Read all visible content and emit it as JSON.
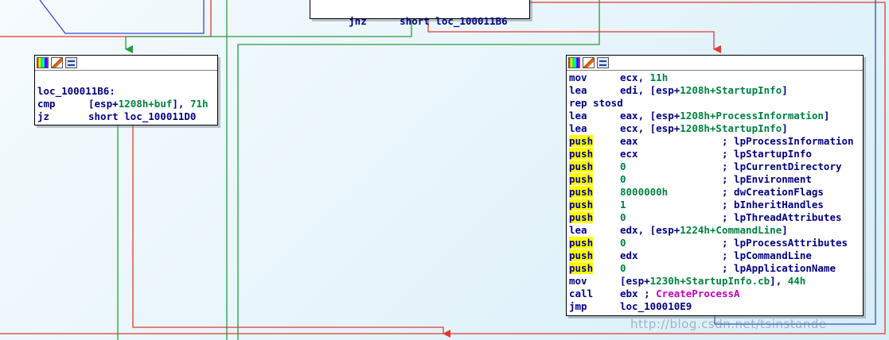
{
  "colors": {
    "accent_true": "#2b9a3b",
    "accent_false": "#e3392f",
    "accent_jump": "#3a46c9",
    "highlight": "#ffff00",
    "mnemonic": "#000080",
    "operand_num": "#008040",
    "api_call": "#c000c0"
  },
  "toolbar_icons": [
    "color-palette-icon",
    "rename-icon",
    "graph-overview-icon"
  ],
  "top_block": {
    "mnemonic": "jnz",
    "operand": "short loc_100011B6"
  },
  "left_block": {
    "label": "loc_100011B6:",
    "lines": [
      {
        "mnemonic": "cmp",
        "parts": [
          {
            "t": "[esp+",
            "c": "lbl"
          },
          {
            "t": "1208h",
            "c": "kw"
          },
          {
            "t": "+buf",
            "c": "kw"
          },
          {
            "t": "], ",
            "c": "lbl"
          },
          {
            "t": "71h",
            "c": "kw"
          }
        ]
      },
      {
        "mnemonic": "jz",
        "parts": [
          {
            "t": "short loc_100011D0",
            "c": "lbl"
          }
        ]
      }
    ]
  },
  "right_block": {
    "lines": [
      {
        "mnemonic": "mov",
        "hl": false,
        "parts": [
          {
            "t": "ecx, ",
            "c": "lbl"
          },
          {
            "t": "11h",
            "c": "kw"
          }
        ],
        "comment": ""
      },
      {
        "mnemonic": "lea",
        "hl": false,
        "parts": [
          {
            "t": "edi, [esp+",
            "c": "lbl"
          },
          {
            "t": "1208h",
            "c": "kw"
          },
          {
            "t": "+StartupInfo",
            "c": "kw"
          },
          {
            "t": "]",
            "c": "lbl"
          }
        ],
        "comment": ""
      },
      {
        "mnemonic": "rep stosd",
        "hl": false,
        "parts": [],
        "comment": ""
      },
      {
        "mnemonic": "lea",
        "hl": false,
        "parts": [
          {
            "t": "eax, [esp+",
            "c": "lbl"
          },
          {
            "t": "1208h",
            "c": "kw"
          },
          {
            "t": "+ProcessInformation",
            "c": "kw"
          },
          {
            "t": "]",
            "c": "lbl"
          }
        ],
        "comment": ""
      },
      {
        "mnemonic": "lea",
        "hl": false,
        "parts": [
          {
            "t": "ecx, [esp+",
            "c": "lbl"
          },
          {
            "t": "1208h",
            "c": "kw"
          },
          {
            "t": "+StartupInfo",
            "c": "kw"
          },
          {
            "t": "]",
            "c": "lbl"
          }
        ],
        "comment": ""
      },
      {
        "mnemonic": "push",
        "hl": true,
        "parts": [
          {
            "t": "eax",
            "c": "lbl"
          }
        ],
        "comment": "; lpProcessInformation"
      },
      {
        "mnemonic": "push",
        "hl": true,
        "parts": [
          {
            "t": "ecx",
            "c": "lbl"
          }
        ],
        "comment": "; lpStartupInfo"
      },
      {
        "mnemonic": "push",
        "hl": true,
        "parts": [
          {
            "t": "0",
            "c": "kw"
          }
        ],
        "comment": "; lpCurrentDirectory"
      },
      {
        "mnemonic": "push",
        "hl": true,
        "parts": [
          {
            "t": "0",
            "c": "kw"
          }
        ],
        "comment": "; lpEnvironment"
      },
      {
        "mnemonic": "push",
        "hl": true,
        "parts": [
          {
            "t": "8000000h",
            "c": "kw"
          }
        ],
        "comment": "; dwCreationFlags"
      },
      {
        "mnemonic": "push",
        "hl": true,
        "parts": [
          {
            "t": "1",
            "c": "kw"
          }
        ],
        "comment": "; bInheritHandles"
      },
      {
        "mnemonic": "push",
        "hl": true,
        "parts": [
          {
            "t": "0",
            "c": "kw"
          }
        ],
        "comment": "; lpThreadAttributes"
      },
      {
        "mnemonic": "lea",
        "hl": false,
        "parts": [
          {
            "t": "edx, [esp+",
            "c": "lbl"
          },
          {
            "t": "1224h",
            "c": "kw"
          },
          {
            "t": "+CommandLine",
            "c": "kw"
          },
          {
            "t": "]",
            "c": "lbl"
          }
        ],
        "comment": ""
      },
      {
        "mnemonic": "push",
        "hl": true,
        "parts": [
          {
            "t": "0",
            "c": "kw"
          }
        ],
        "comment": "; lpProcessAttributes"
      },
      {
        "mnemonic": "push",
        "hl": true,
        "parts": [
          {
            "t": "edx",
            "c": "lbl"
          }
        ],
        "comment": "; lpCommandLine"
      },
      {
        "mnemonic": "push",
        "hl": true,
        "parts": [
          {
            "t": "0",
            "c": "kw"
          }
        ],
        "comment": "; lpApplicationName"
      },
      {
        "mnemonic": "mov",
        "hl": false,
        "parts": [
          {
            "t": "[esp+",
            "c": "lbl"
          },
          {
            "t": "1230h",
            "c": "kw"
          },
          {
            "t": "+StartupInfo.cb",
            "c": "kw"
          },
          {
            "t": "], ",
            "c": "lbl"
          },
          {
            "t": "44h",
            "c": "kw"
          }
        ],
        "comment": ""
      },
      {
        "mnemonic": "call",
        "hl": false,
        "parts": [
          {
            "t": "ebx ; ",
            "c": "lbl"
          },
          {
            "t": "CreateProcessA",
            "c": "fn"
          }
        ],
        "comment": ""
      },
      {
        "mnemonic": "jmp",
        "hl": false,
        "parts": [
          {
            "t": "loc_100010E9",
            "c": "lbl"
          }
        ],
        "comment": ""
      }
    ]
  },
  "watermark": "http://blog.csdn.net/tsinstande"
}
